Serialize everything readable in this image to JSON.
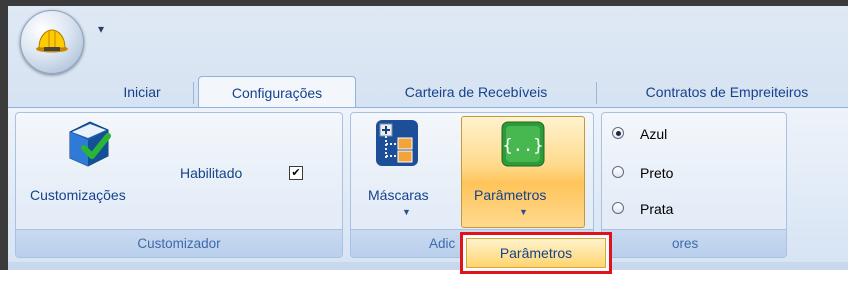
{
  "qat": {
    "arrow": "▾"
  },
  "tabs": [
    {
      "label": "Iniciar",
      "active": false
    },
    {
      "label": "Configurações",
      "active": true
    },
    {
      "label": "Carteira de Recebíveis",
      "active": false
    },
    {
      "label": "Contratos de Empreiteiros",
      "active": false
    }
  ],
  "groups": {
    "customizador": {
      "label": "Customizador",
      "customizacoes_label": "Customizações",
      "habilitado_label": "Habilitado",
      "habilitado_checked": true
    },
    "adic": {
      "label": "Adic",
      "mascaras_label": "Máscaras",
      "parametros_label": "Parâmetros"
    },
    "cores": {
      "label": "ores",
      "options": [
        {
          "label": "Azul",
          "selected": true
        },
        {
          "label": "Preto",
          "selected": false
        },
        {
          "label": "Prata",
          "selected": false
        }
      ]
    }
  },
  "dropdown_menu": {
    "item": "Parâmetros"
  },
  "colors": {
    "text_blue": "#15428b",
    "highlight_border": "#e0131b",
    "hover_gold": "#ffc45a"
  }
}
